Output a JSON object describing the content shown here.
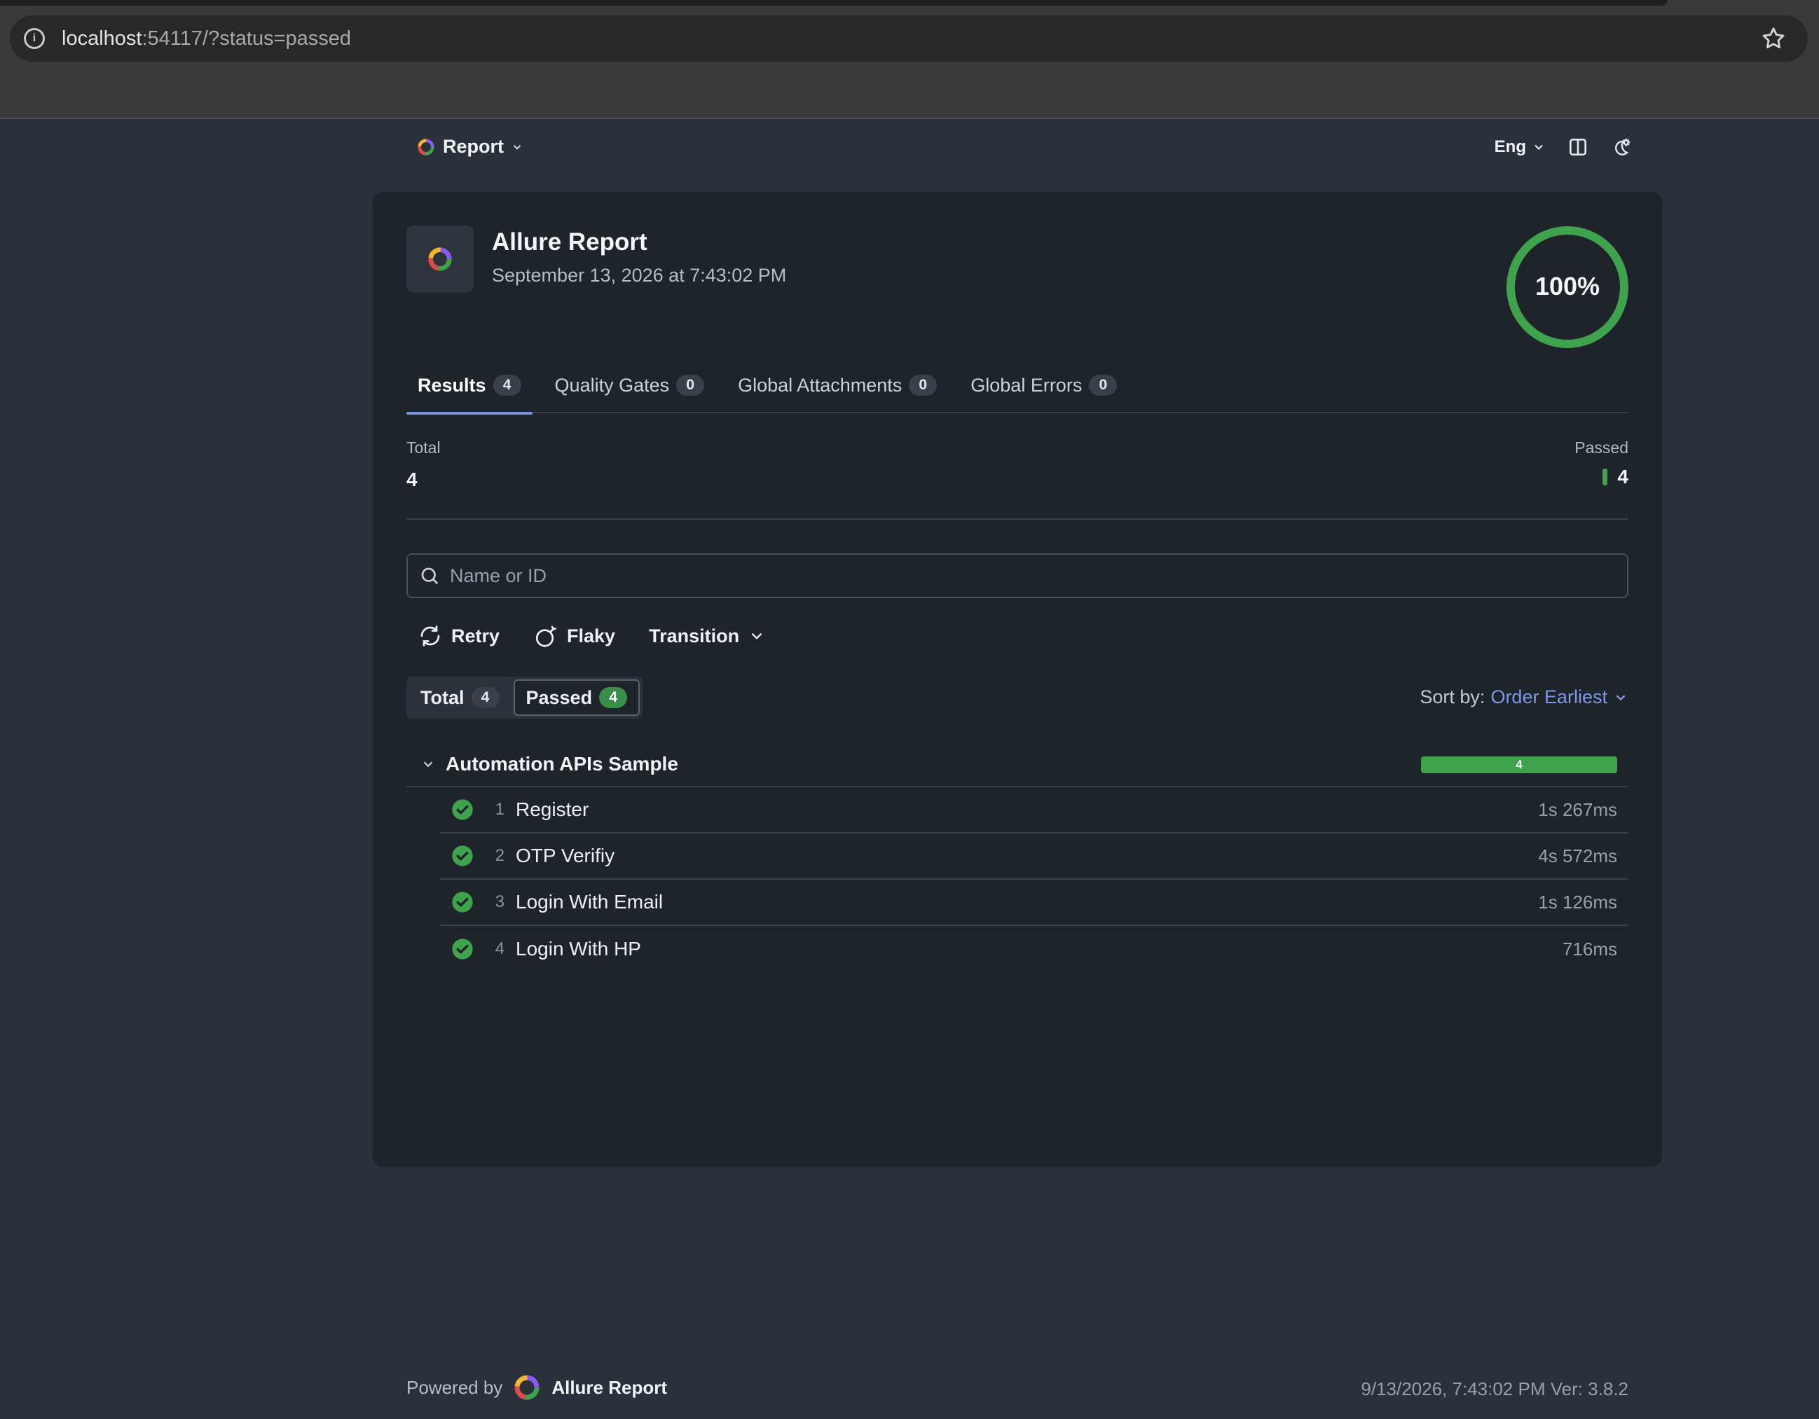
{
  "browser": {
    "url_host": "localhost",
    "url_rest": ":54117/?status=passed"
  },
  "header": {
    "report_menu_label": "Report",
    "language": "Eng"
  },
  "report": {
    "title": "Allure Report",
    "datetime": "September 13, 2026 at 7:43:02 PM",
    "pass_rate": "100%",
    "pass_rate_value": 1.0
  },
  "tabs": [
    {
      "label": "Results",
      "count": "4",
      "active": true
    },
    {
      "label": "Quality Gates",
      "count": "0"
    },
    {
      "label": "Global Attachments",
      "count": "0"
    },
    {
      "label": "Global Errors",
      "count": "0"
    }
  ],
  "stats": {
    "total_label": "Total",
    "total_value": "4",
    "passed_label": "Passed",
    "passed_value": "4"
  },
  "search": {
    "placeholder": "Name or ID"
  },
  "filters": {
    "retry": "Retry",
    "flaky": "Flaky",
    "transition": "Transition"
  },
  "status_filter": {
    "total_label": "Total",
    "total_count": "4",
    "passed_label": "Passed",
    "passed_count": "4"
  },
  "sort": {
    "prefix": "Sort by:",
    "value": "Order Earliest"
  },
  "group": {
    "name": "Automation APIs Sample",
    "passed_count": "4",
    "tests": [
      {
        "num": "1",
        "name": "Register",
        "duration": "1s 267ms"
      },
      {
        "num": "2",
        "name": "OTP Verifiy",
        "duration": "4s 572ms"
      },
      {
        "num": "3",
        "name": "Login With Email",
        "duration": "1s 126ms"
      },
      {
        "num": "4",
        "name": "Login With HP",
        "duration": "716ms"
      }
    ]
  },
  "footer": {
    "powered_by": "Powered by",
    "brand": "Allure Report",
    "meta": "9/13/2026, 7:43:02 PM Ver: 3.8.2"
  },
  "colors": {
    "passed": "#3fa34d",
    "accent": "#7b93e0",
    "card_bg": "#1f232a",
    "page_bg": "#2b313b"
  }
}
